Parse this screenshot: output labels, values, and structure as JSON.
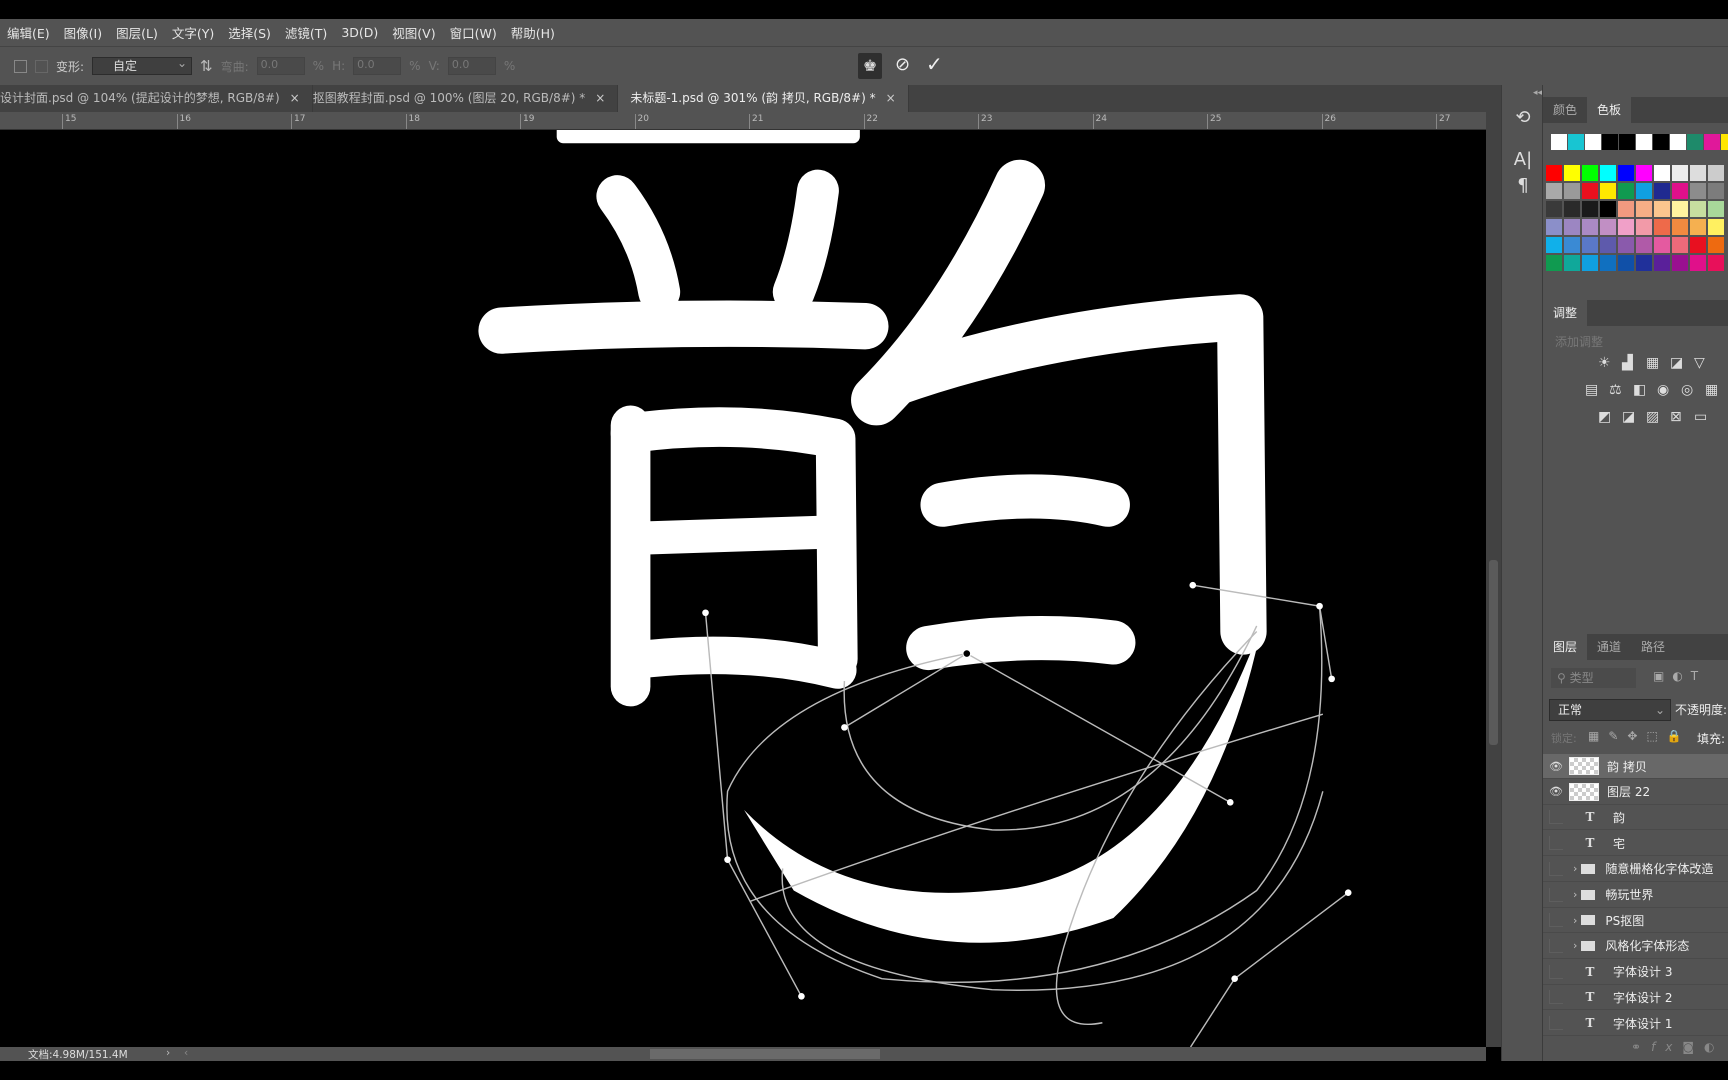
{
  "menu": [
    "编辑(E)",
    "图像(I)",
    "图层(L)",
    "文字(Y)",
    "选择(S)",
    "滤镜(T)",
    "3D(D)",
    "视图(V)",
    "窗口(W)",
    "帮助(H)"
  ],
  "options": {
    "warp_label": "变形:",
    "warp_value": "自定",
    "bend_label": "弯曲:",
    "bend_value": "0.0",
    "h_label": "H:",
    "h_value": "0.0",
    "v_label": "V:",
    "v_value": "0.0",
    "pct": "%",
    "warp_icon": "warp-mode-icon",
    "cancel_icon": "cancel-icon",
    "commit_icon": "checkmark-icon"
  },
  "tabs": [
    {
      "label": "设计封面.psd @ 104% (提起设计的梦想, RGB/8#)",
      "close": "×"
    },
    {
      "label": "抠图教程封面.psd @ 100% (图层 20, RGB/8#) *",
      "close": "×"
    },
    {
      "label": "未标题-1.psd @ 301% (韵 拷贝, RGB/8#) *",
      "close": "×",
      "active": true
    }
  ],
  "ruler": [
    "15",
    "16",
    "17",
    "18",
    "19",
    "20",
    "21",
    "22",
    "23",
    "24",
    "25",
    "26",
    "27"
  ],
  "status": {
    "doc": "文档:4.98M/151.4M"
  },
  "panels": {
    "color_tabs": [
      "颜色",
      "色板"
    ],
    "swatch_recent": [
      "#ffffff",
      "#18c5d2",
      "#ffffff",
      "#000000",
      "#000000",
      "#ffffff",
      "#000000",
      "#ffffff",
      "#1e8a6a",
      "#e0189a",
      "#ffe600"
    ],
    "swatch_rows": [
      [
        "#ff0000",
        "#ffff00",
        "#00ff00",
        "#00ffff",
        "#0000ff",
        "#ff00ff",
        "#ffffff",
        "#eeeeee",
        "#dddddd",
        "#cccccc"
      ],
      [
        "#a9a9a9",
        "#9a9a9a",
        "#e8101e",
        "#ffe800",
        "#109a50",
        "#10a0e0",
        "#202a90",
        "#e0108a",
        "#8c8c8c",
        "#7c7c7c"
      ],
      [
        "#3a3a3a",
        "#2a2a2a",
        "#1a1a1a",
        "#000000",
        "#f29a80",
        "#f6ae86",
        "#fbc68e",
        "#fff3a0",
        "#c7dea0",
        "#a8d89a"
      ],
      [
        "#8b8fc9",
        "#9c86c2",
        "#aa8ac4",
        "#c18fc4",
        "#f0a0c8",
        "#f29aa8",
        "#ee6a4a",
        "#f28a40",
        "#f5b050",
        "#fff060"
      ],
      [
        "#10b0ea",
        "#3a8ad4",
        "#5a78c8",
        "#5e5aac",
        "#8a5aac",
        "#b05aa8",
        "#e45aa0",
        "#ee6a7a",
        "#e81020",
        "#ee6a10"
      ],
      [
        "#109a50",
        "#10a89a",
        "#10a0e0",
        "#1070c0",
        "#1050a8",
        "#20309a",
        "#5a209a",
        "#9a1090",
        "#e0108a",
        "#e8105a"
      ]
    ],
    "adjust_tab": "调整",
    "adjust_hint": "添加调整",
    "adjust_icons": [
      [
        "brightness-icon",
        "levels-icon",
        "curves-icon",
        "exposure-icon",
        "vibrance-icon"
      ],
      [
        "hsl-icon",
        "color-balance-icon",
        "bw-icon",
        "photo-filter-icon",
        "channel-mixer-icon",
        "color-lookup-icon"
      ],
      [
        "invert-icon",
        "posterize-icon",
        "threshold-icon",
        "selective-color-icon",
        "gradient-map-icon"
      ]
    ],
    "layer_tabs": [
      "图层",
      "通道",
      "路径"
    ],
    "filter_placeholder": "类型",
    "blend_mode": "正常",
    "opacity_label": "不透明度:",
    "lock_label": "锁定:",
    "fill_label": "填充:",
    "layers": [
      {
        "name": "韵 拷贝",
        "kind": "pixel",
        "visible": true,
        "selected": true
      },
      {
        "name": "图层 22",
        "kind": "pixel",
        "visible": true
      },
      {
        "name": "韵",
        "kind": "text",
        "visible": false
      },
      {
        "name": "宅",
        "kind": "text",
        "visible": false
      },
      {
        "name": "随意栅格化字体改造",
        "kind": "group",
        "visible": false
      },
      {
        "name": "畅玩世界",
        "kind": "group",
        "visible": false
      },
      {
        "name": "PS抠图",
        "kind": "group",
        "visible": false
      },
      {
        "name": "风格化字体形态",
        "kind": "group",
        "visible": false
      },
      {
        "name": "字体设计 3",
        "kind": "text",
        "visible": false
      },
      {
        "name": "字体设计 2",
        "kind": "text",
        "visible": false
      },
      {
        "name": "字体设计 1",
        "kind": "text",
        "visible": false
      }
    ],
    "layer_footer_icons": [
      "link-icon",
      "fx-icon",
      "mask-icon",
      "adjustment-icon"
    ]
  }
}
